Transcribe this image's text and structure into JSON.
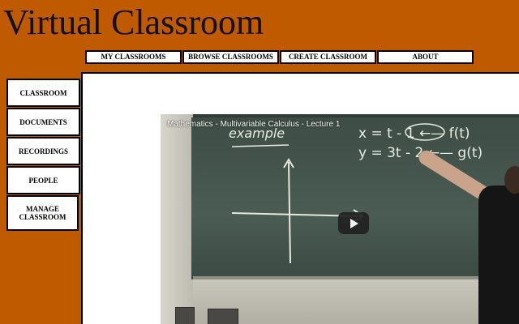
{
  "site": {
    "title": "Virtual Classroom"
  },
  "top_nav": [
    {
      "label": "MY CLASSROOMS"
    },
    {
      "label": "BROWSE CLASSROOMS"
    },
    {
      "label": "CREATE CLASSROOM"
    },
    {
      "label": "ABOUT"
    }
  ],
  "side_nav": [
    {
      "label": "CLASSROOM"
    },
    {
      "label": "DOCUMENTS"
    },
    {
      "label": "RECORDINGS"
    },
    {
      "label": "PEOPLE"
    },
    {
      "label": "MANAGE CLASSROOM"
    }
  ],
  "video": {
    "title": "Mathematics - Multivariable Calculus - Lecture 1",
    "play_icon": "play-icon",
    "board_text": {
      "heading": "example",
      "line1": "x = t - 1  ←— f(t)",
      "line2": "y = 3t - 2  ←— g(t)"
    }
  },
  "colors": {
    "page_background": "#c05a00",
    "panel_background": "#ffffff",
    "button_background": "#ffffff",
    "play_button": "#212121"
  }
}
